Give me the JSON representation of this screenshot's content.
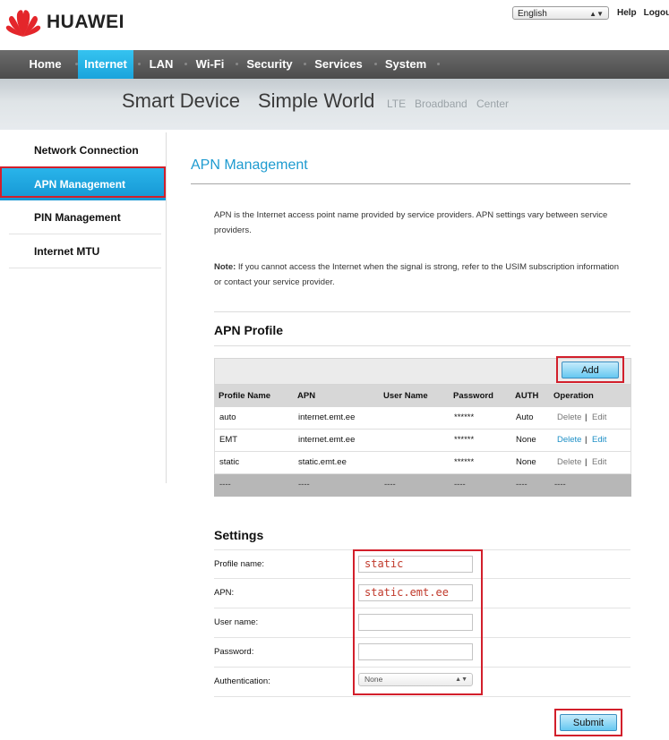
{
  "header": {
    "brand": "HUAWEI",
    "language": "English",
    "help": "Help",
    "logout": "Logout"
  },
  "nav": [
    "Home",
    "Internet",
    "LAN",
    "Wi-Fi",
    "Security",
    "Services",
    "System"
  ],
  "banner": {
    "tagline_1": "Smart Device",
    "tagline_2": "Simple World",
    "sub_1": "LTE",
    "sub_2": "Broadband",
    "sub_3": "Center"
  },
  "sidebar": {
    "items": [
      {
        "label": "Network Connection"
      },
      {
        "label": "APN Management"
      },
      {
        "label": "PIN Management"
      },
      {
        "label": "Internet MTU"
      }
    ]
  },
  "page": {
    "title": "APN Management",
    "intro": "APN is the Internet access point name provided by service providers. APN settings vary between service providers.",
    "note_label": "Note:",
    "note": " If you cannot access the Internet when the signal is strong, refer to the USIM subscription information or contact your service provider."
  },
  "apn_profile": {
    "title": "APN Profile",
    "add_label": "Add",
    "columns": [
      "Profile Name",
      "APN",
      "User Name",
      "Password",
      "AUTH",
      "Operation"
    ],
    "rows": [
      {
        "name": "auto",
        "apn": "internet.emt.ee",
        "user": "",
        "password": "******",
        "auth": "Auto",
        "delete": "Delete",
        "sep": "|",
        "edit": "Edit"
      },
      {
        "name": "EMT",
        "apn": "internet.emt.ee",
        "user": "",
        "password": "******",
        "auth": "None",
        "delete": "Delete",
        "sep": "|",
        "edit": "Edit"
      },
      {
        "name": "static",
        "apn": "static.emt.ee",
        "user": "",
        "password": "******",
        "auth": "None",
        "delete": "Delete",
        "sep": "|",
        "edit": "Edit"
      }
    ],
    "footer_cells": [
      "----",
      "----",
      "----",
      "----",
      "----",
      "----"
    ]
  },
  "settings": {
    "title": "Settings",
    "profile_name_label": "Profile name:",
    "profile_name_value": "static",
    "apn_label": "APN:",
    "apn_value": "static.emt.ee",
    "user_name_label": "User name:",
    "user_name_value": "",
    "password_label": "Password:",
    "password_value": "",
    "authentication_label": "Authentication:",
    "authentication_value": "None",
    "submit_label": "Submit"
  },
  "colors": {
    "accent": "#1e9bd0",
    "highlight_border": "#d21f2b",
    "nav_bg": "#5a5a5a",
    "nav_active": "#26b2e6"
  }
}
